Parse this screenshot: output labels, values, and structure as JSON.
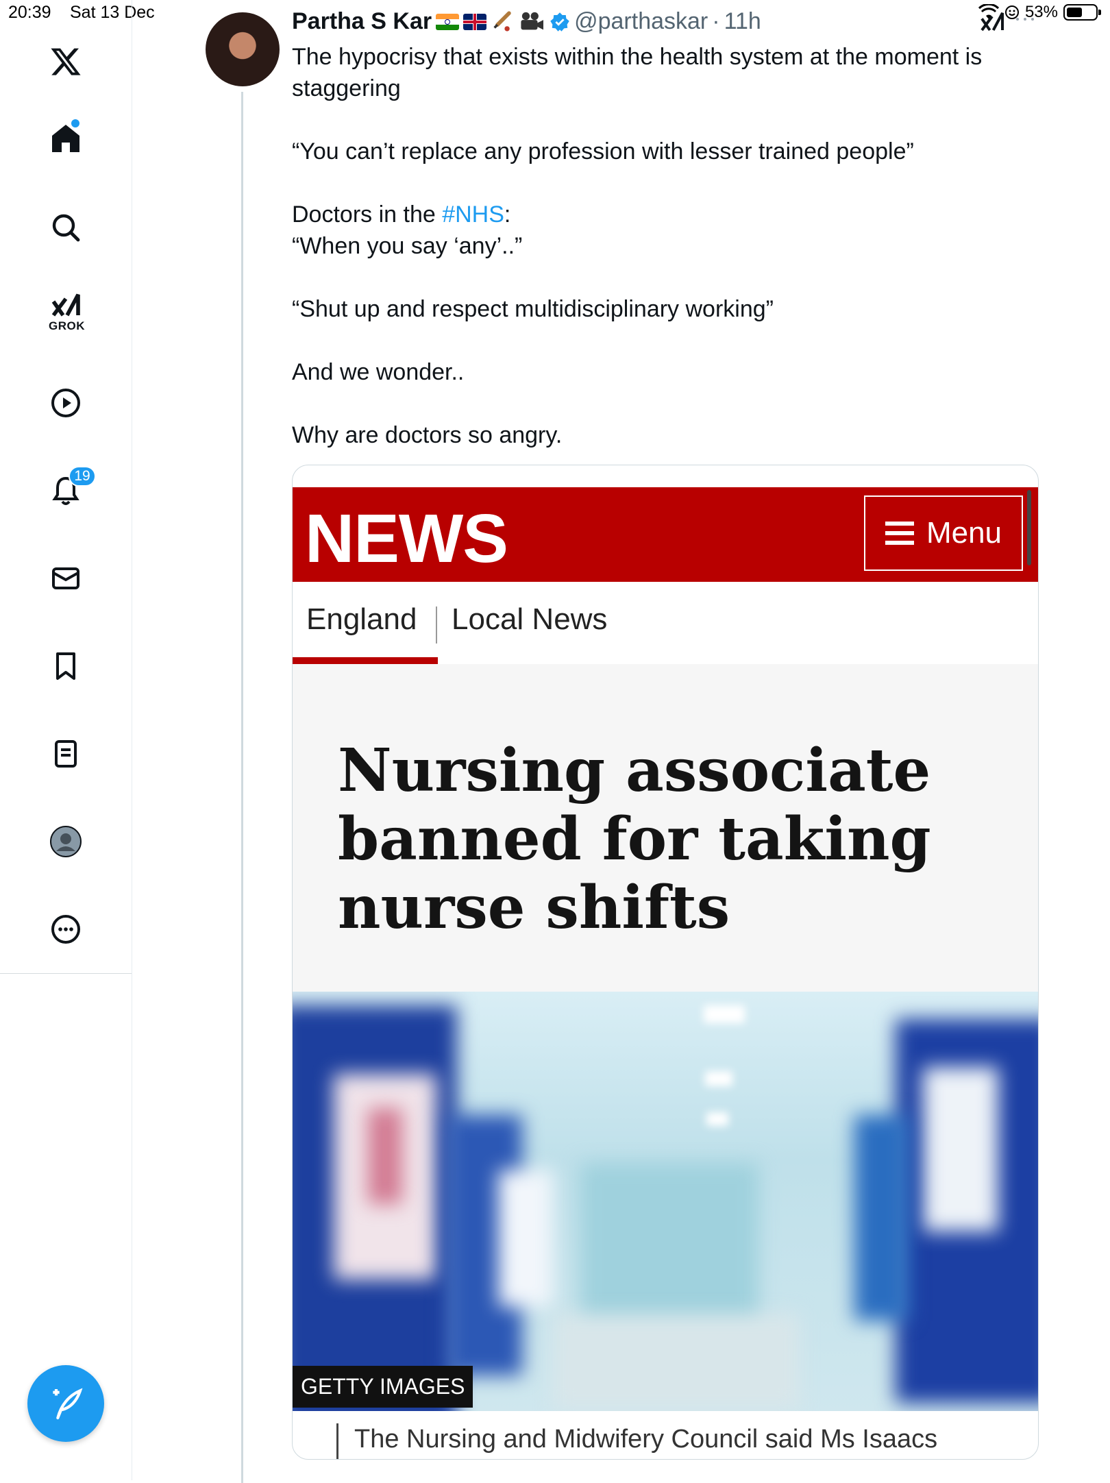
{
  "status_bar": {
    "time": "20:39",
    "date": "Sat 13 Dec",
    "battery": "53%"
  },
  "sidebar": {
    "items": [
      {
        "name": "home",
        "icon": "home-icon",
        "active": true
      },
      {
        "name": "explore",
        "icon": "search-icon"
      },
      {
        "name": "grok",
        "icon": "grok-icon",
        "label": "GROK"
      },
      {
        "name": "videos",
        "icon": "play-icon"
      },
      {
        "name": "notifications",
        "icon": "bell-icon",
        "badge": "19"
      },
      {
        "name": "messages",
        "icon": "mail-icon"
      },
      {
        "name": "bookmarks",
        "icon": "bookmark-icon"
      },
      {
        "name": "lists",
        "icon": "list-icon"
      },
      {
        "name": "profile",
        "icon": "profile-icon"
      },
      {
        "name": "more",
        "icon": "more-icon"
      }
    ],
    "compose_icon": "compose-icon"
  },
  "tweet": {
    "author": "Partha S Kar",
    "handle": "@parthaskar",
    "separator": "·",
    "time": "11h",
    "lines": {
      "p1": "The hypocrisy that exists within the health system at the moment is staggering",
      "p2": "“You can’t replace any profession with lesser trained people”",
      "p3_prefix": "Doctors in the ",
      "p3_hashtag": "#NHS",
      "p3_suffix": ":",
      "p4": "“When you say ‘any’..”",
      "p5": "“Shut up and respect multidisciplinary working”",
      "p6": "And we wonder..",
      "p7": "Why are doctors so angry."
    }
  },
  "card": {
    "brand": "NEWS",
    "menu_label": "Menu",
    "nav_england": "England",
    "nav_local": "Local News",
    "headline": "Nursing associate banned for taking nurse shifts",
    "image_credit": "GETTY IMAGES",
    "caption": "The Nursing and Midwifery Council said Ms Isaacs",
    "accent_color": "#b80000"
  },
  "colors": {
    "link": "#1d9bf0",
    "verified": "#1d9bf0"
  }
}
